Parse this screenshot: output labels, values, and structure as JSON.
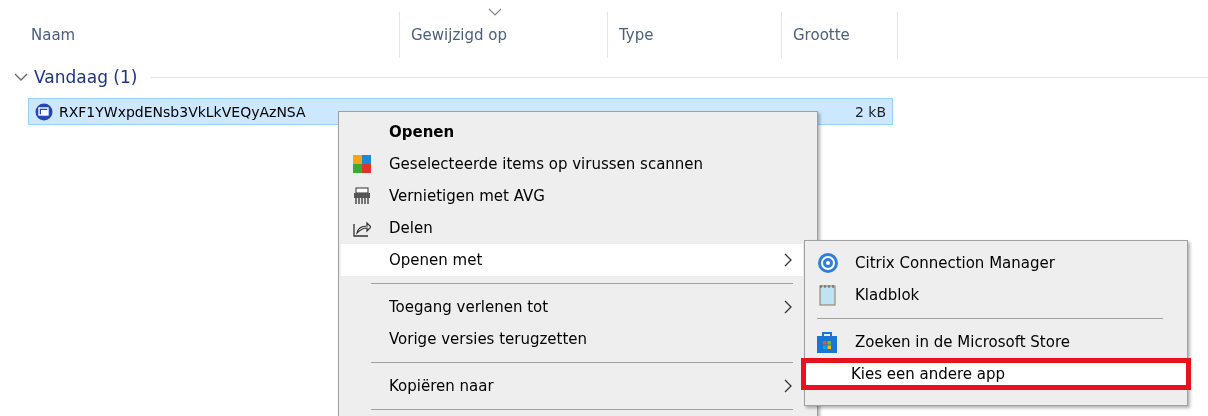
{
  "columns": [
    {
      "label": "Naam",
      "sorted": false
    },
    {
      "label": "Gewijzigd op",
      "sorted": true
    },
    {
      "label": "Type",
      "sorted": false
    },
    {
      "label": "Grootte",
      "sorted": false
    }
  ],
  "group": {
    "label": "Vandaag (1)",
    "expanded": true
  },
  "file": {
    "name": "RXF1YWxpdENsb3VkLkVEQyAzNSA",
    "size": "2 kB",
    "selected": true
  },
  "menu": [
    {
      "kind": "item",
      "label": "Openen",
      "bold": true,
      "selected": false,
      "submenu": false
    },
    {
      "kind": "item",
      "label": "Geselecteerde items op virussen scannen",
      "bold": false,
      "selected": false,
      "submenu": false
    },
    {
      "kind": "item",
      "label": "Vernietigen met AVG",
      "bold": false,
      "selected": false,
      "submenu": false
    },
    {
      "kind": "item",
      "label": "Delen",
      "bold": false,
      "selected": false,
      "submenu": false
    },
    {
      "kind": "item",
      "label": "Openen met",
      "bold": false,
      "selected": true,
      "submenu": true
    },
    {
      "kind": "separator"
    },
    {
      "kind": "item",
      "label": "Toegang verlenen tot",
      "bold": false,
      "selected": false,
      "submenu": true
    },
    {
      "kind": "item",
      "label": "Vorige versies terugzetten",
      "bold": false,
      "selected": false,
      "submenu": false
    },
    {
      "kind": "separator"
    },
    {
      "kind": "item",
      "label": "Kopiëren naar",
      "bold": false,
      "selected": false,
      "submenu": true
    },
    {
      "kind": "separator"
    }
  ],
  "submenu": [
    {
      "kind": "item",
      "label": "Citrix Connection Manager",
      "selected": false,
      "marked": false
    },
    {
      "kind": "item",
      "label": "Kladblok",
      "selected": false,
      "marked": false
    },
    {
      "kind": "separator"
    },
    {
      "kind": "item",
      "label": "Zoeken in de Microsoft Store",
      "selected": false,
      "marked": false
    },
    {
      "kind": "item",
      "label": "Kies een andere app",
      "selected": true,
      "marked": true
    }
  ]
}
